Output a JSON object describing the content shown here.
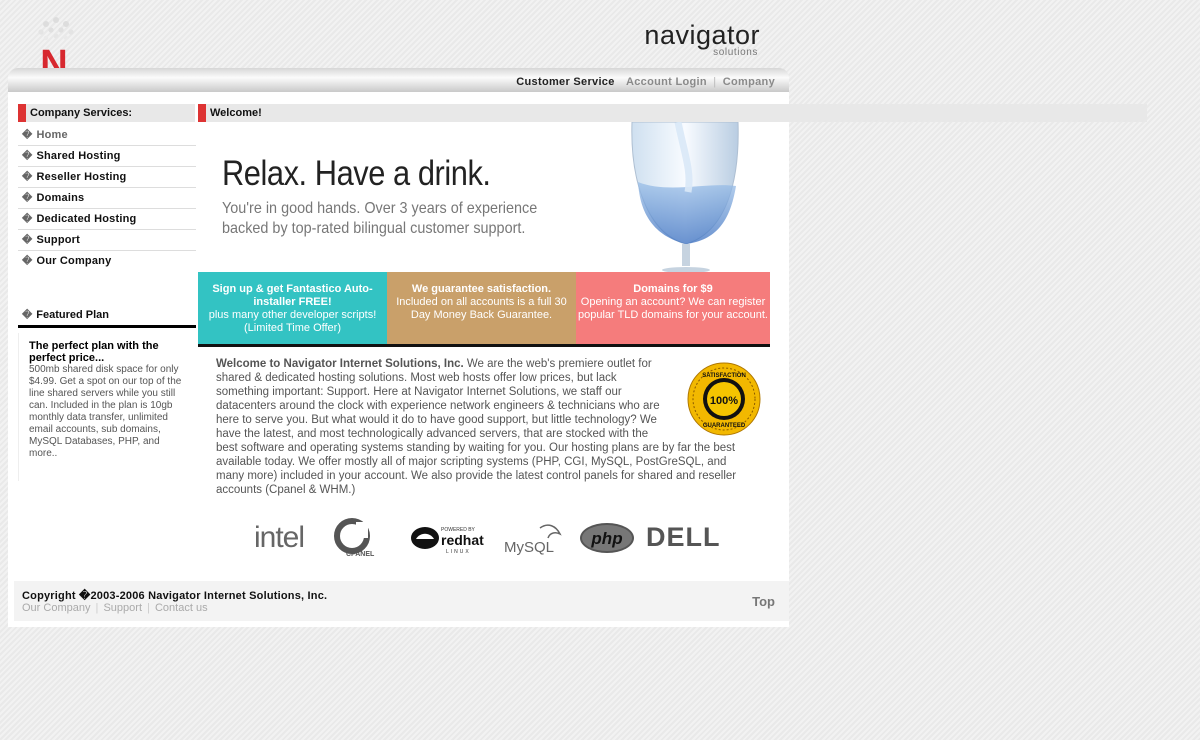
{
  "header": {
    "logo_letter": "N",
    "brand_name": "navigator",
    "brand_sub": "solutions",
    "nav": {
      "customer_service": "Customer Service",
      "account_login": "Account Login",
      "company": "Company",
      "separator": "|"
    }
  },
  "sidebar": {
    "title": "Company Services:",
    "items": [
      {
        "label": "Home"
      },
      {
        "label": "Shared Hosting"
      },
      {
        "label": "Reseller Hosting"
      },
      {
        "label": "Domains"
      },
      {
        "label": "Dedicated Hosting"
      },
      {
        "label": "Support"
      },
      {
        "label": "Our Company"
      }
    ],
    "bullet": "�",
    "featured": {
      "title": "Featured Plan",
      "headline": "The perfect plan with the perfect price...",
      "text": "500mb shared disk space for only $4.99. Get a spot on our top of the line shared servers while you still can. Included in the plan is 10gb monthly data transfer, unlimited email accounts, sub domains, MySQL Databases, PHP, and more.."
    }
  },
  "welcome": {
    "title": "Welcome!",
    "hero_title": "Relax. Have a drink.",
    "hero_sub": "You're in good hands. Over 3 years of experience backed by top-rated bilingual customer support.",
    "promos": [
      {
        "headline": "Sign up & get Fantastico Auto-installer FREE!",
        "text": "plus many other developer scripts! (Limited Time Offer)"
      },
      {
        "headline": "We guarantee satisfaction.",
        "text": "Included on all accounts is a full 30 Day Money Back Guarantee."
      },
      {
        "headline": "Domains for $9",
        "text": "Opening an account? We can register popular TLD domains for your account."
      }
    ],
    "intro_bold": "Welcome to Navigator Internet Solutions, Inc.",
    "intro_text": " We are the web's premiere outlet for shared & dedicated hosting solutions. Most web hosts offer low prices, but lack something important: Support. Here at Navigator Internet Solutions, we staff our datacenters around the clock with experience network engineers & technicians who are here to serve you. But what would it do to have good support, but little technology? We have the latest, and most technologically advanced servers, that are stocked with the best software and operating systems standing by waiting for you. Our hosting plans are by far the best available today. We offer mostly all of major scripting systems (PHP, CGI, MySQL, PostGreSQL, and many more) included in your account. We also provide the latest control panels for shared and reseller accounts (Cpanel & WHM.)",
    "seal": {
      "top": "SATISFACTION",
      "center": "100%",
      "bottom": "GUARANTEED"
    },
    "logos": {
      "intel": "intel",
      "cpanel": "CPANEL",
      "redhat_powered": "POWERED BY",
      "redhat": "redhat",
      "redhat_linux": "LINUX",
      "mysql": "MySQL",
      "php": "php",
      "dell": "DELL"
    }
  },
  "footer": {
    "copyright": "Copyright �2003-2006 Navigator Internet Solutions, Inc.",
    "links": [
      "Our Company",
      "Support",
      "Contact us"
    ],
    "separator": "|",
    "top": "Top"
  },
  "colors": {
    "accent_red": "#dd3333",
    "teal": "#33c3c3",
    "tan": "#c9a06a",
    "salmon": "#f57c7c"
  }
}
